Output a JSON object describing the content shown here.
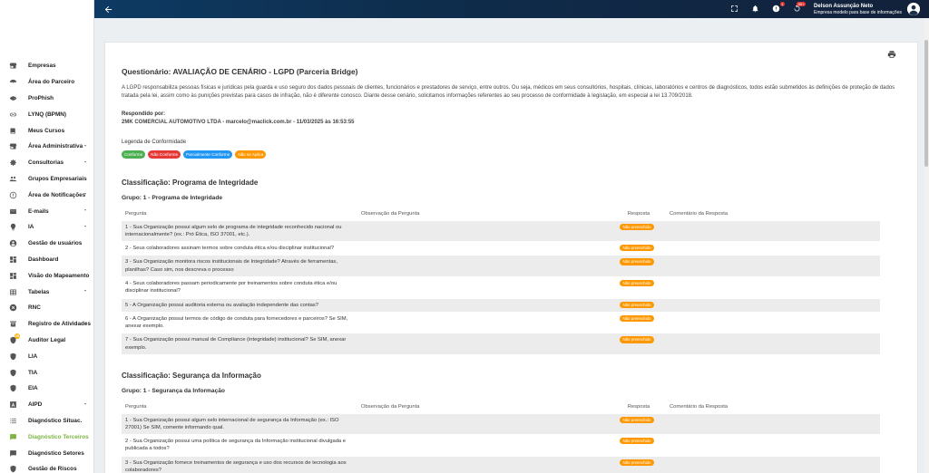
{
  "sidebar": {
    "items": [
      {
        "label": "Empresas",
        "icon": "store-icon",
        "chevron": false
      },
      {
        "label": "Área do Parceiro",
        "icon": "handshake-icon",
        "chevron": false
      },
      {
        "label": "ProPhish",
        "icon": "fish-icon",
        "chevron": false
      },
      {
        "label": "LYNQ (BPMN)",
        "icon": "link-icon",
        "chevron": false
      },
      {
        "label": "Meus Cursos",
        "icon": "book-icon",
        "chevron": false
      },
      {
        "label": "Área Administrativa",
        "icon": "store-icon",
        "chevron": true
      },
      {
        "label": "Consultorias",
        "icon": "gear-icon",
        "chevron": true
      },
      {
        "label": "Grupos Empresariais",
        "icon": "group-icon",
        "chevron": false
      },
      {
        "label": "Área de Notificações",
        "icon": "alert-icon",
        "chevron": true
      },
      {
        "label": "E-mails",
        "icon": "mail-icon",
        "chevron": true
      },
      {
        "label": "IA",
        "icon": "bulb-icon",
        "chevron": true
      },
      {
        "label": "Gestão de usuários",
        "icon": "user-icon",
        "chevron": false
      },
      {
        "label": "Dashboard",
        "icon": "dashboard-icon",
        "chevron": false
      },
      {
        "label": "Visão do Mapeamento",
        "icon": "dashboard-icon",
        "chevron": false
      },
      {
        "label": "Tabelas",
        "icon": "table-icon",
        "chevron": true
      },
      {
        "label": "RNC",
        "icon": "close-circle-icon",
        "chevron": false
      },
      {
        "label": "Registro de Atividades",
        "icon": "activity-icon",
        "chevron": true
      },
      {
        "label": "Auditor Legal",
        "icon": "shield-icon",
        "chevron": false,
        "badge": "28"
      },
      {
        "label": "LIA",
        "icon": "shield-icon",
        "chevron": false
      },
      {
        "label": "TIA",
        "icon": "shield-icon",
        "chevron": false
      },
      {
        "label": "EIA",
        "icon": "shield-icon",
        "chevron": false
      },
      {
        "label": "AIPD",
        "icon": "font-icon",
        "chevron": true
      },
      {
        "label": "Diagnóstico Situac.",
        "icon": "list-icon",
        "chevron": false
      },
      {
        "label": "Diagnóstico Terceiros",
        "icon": "chat-icon",
        "chevron": false,
        "active": true
      },
      {
        "label": "Diagnóstico Setores",
        "icon": "chat-icon",
        "chevron": false
      },
      {
        "label": "Gestão de Riscos",
        "icon": "shield-icon",
        "chevron": false
      }
    ]
  },
  "topbar": {
    "user_name": "Delson Assunção Neto",
    "user_company": "Empresa modelo para base de informações",
    "badge_alerts": "1",
    "badge_updates": "99+"
  },
  "header": {
    "title": "Questionário: AVALIAÇÃO DE CENÁRIO - LGPD (Parceria Bridge)",
    "description": "A LGPD responsabiliza pessoas físicas e jurídicas pela guarda e uso seguro dos dados pessoais de clientes, funcionários e prestadores de serviço, entre outros. Ou seja, médicos em seus consultórios, hospitais, clínicas, laboratórios e centros de diagnósticos, todos estão submetidos às definições de proteção de dados tratada pela lei, assim como às punições previstas para casos de infração, não é diferente conosco. Diante desse cenário, solicitamos informações referentes ao seu processo de conformidade à legislação, em especial a lei 13.709/2018.",
    "responded_label": "Respondido por:",
    "responded_value": "2MK COMERCIAL AUTOMOTIVO LTDA - marcelo@maclick.com.br - 11/03/2025 às 16:53:55",
    "legend_title": "Legenda de Conformidade",
    "legend": [
      "Conforme",
      "Não Conforme",
      "Parcialmente Conforme",
      "Não se Aplica"
    ]
  },
  "columns": [
    "Pergunta",
    "Observação da Pergunta",
    "Resposta",
    "Comentário da Resposta"
  ],
  "sections": [
    {
      "classification": "Classificação: Programa de Integridade",
      "group": "Grupo: 1 - Programa de Integridade",
      "rows": [
        {
          "q": "1 - Sua Organização possui algum selo de programa de integridade reconhecido nacional ou internacionalmente? (ex.: Pró Ética, ISO 37001, etc.).",
          "resp": "Não preenchido"
        },
        {
          "q": "2 - Seus colaboradores assinam termos sobre conduta ética e/ou disciplinar institucional?",
          "resp": "Não preenchido"
        },
        {
          "q": "3 - Sua Organização monitora riscos institucionais de Integridade? Através de ferramentas, planilhas? Caso sim, nos descreva o processo",
          "resp": "Não preenchido"
        },
        {
          "q": "4 - Seus colaboradores passam periodicamente por treinamentos sobre conduta ética e/ou disciplinar institucional?",
          "resp": "Não preenchido"
        },
        {
          "q": "5 - A Organização possui auditoria externa ou avaliação independente das contas?",
          "resp": "Não preenchido"
        },
        {
          "q": "6 - A Organização possui termos de código de conduta para fornecedores e parceiros? Se SIM, anexar exemplo.",
          "resp": "Não preenchido"
        },
        {
          "q": "7 - Sua Organização possui manual de Compliance (integridade) institucional? Se SIM, anexar exemplo.",
          "resp": "Não preenchido"
        }
      ]
    },
    {
      "classification": "Classificação: Segurança da Informação",
      "group": "Grupo: 1 - Segurança da Informação",
      "rows": [
        {
          "q": "1 - Sua Organização possui algum selo internacional de segurança da Informação (ex.: ISO 27001) Se SIM, comente informando qual.",
          "resp": "Não preenchido"
        },
        {
          "q": "2 - Sua Organização possui uma política de segurança da Informação institucional divulgada e publicada a todos?",
          "resp": "Não preenchido"
        },
        {
          "q": "3 - Sua Organização fornece treinamentos de segurança e uso dos recursos de tecnologia aos colaboradores?",
          "resp": "Não preenchido"
        }
      ]
    }
  ]
}
